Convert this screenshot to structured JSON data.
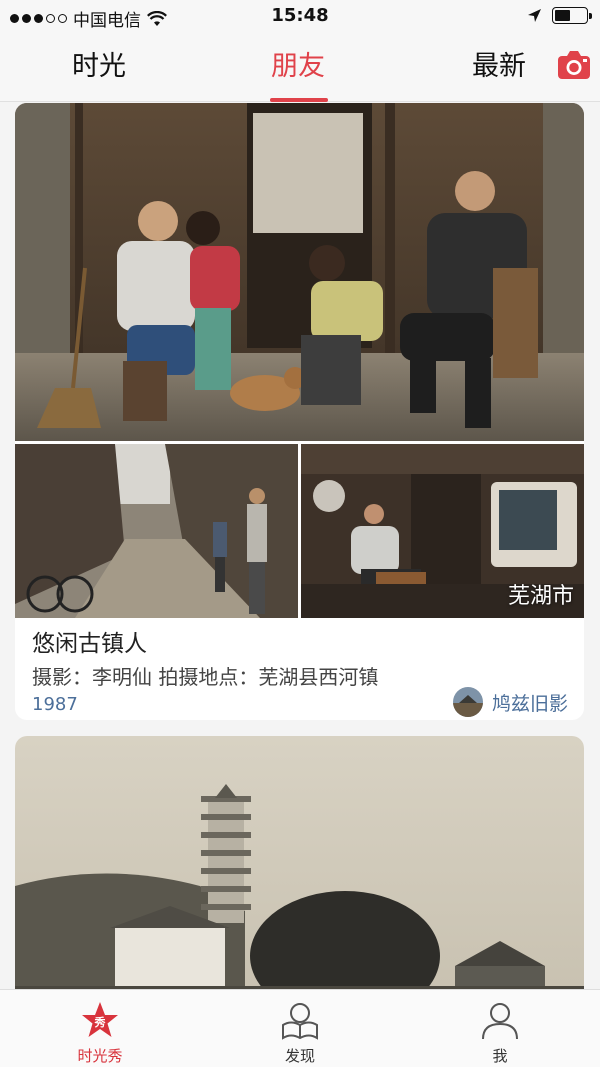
{
  "status_bar": {
    "carrier": "中国电信",
    "time": "15:48"
  },
  "top_tabs": {
    "items": [
      {
        "label": "时光"
      },
      {
        "label": "朋友"
      },
      {
        "label": "最新"
      }
    ],
    "active_index": 1,
    "accent_color": "#e0424a"
  },
  "feed": {
    "posts": [
      {
        "title": "悠闲古镇人",
        "caption": "摄影：李明仙 拍摄地点：芜湖县西河镇",
        "year": "1987",
        "author": "鸠兹旧影",
        "location_tag": "芜湖市"
      }
    ]
  },
  "bottom_tabs": {
    "items": [
      {
        "label": "时光秀",
        "icon": "star-badge-icon"
      },
      {
        "label": "发现",
        "icon": "discover-icon"
      },
      {
        "label": "我",
        "icon": "person-icon"
      }
    ],
    "active_index": 0,
    "active_color": "#d8333c"
  }
}
